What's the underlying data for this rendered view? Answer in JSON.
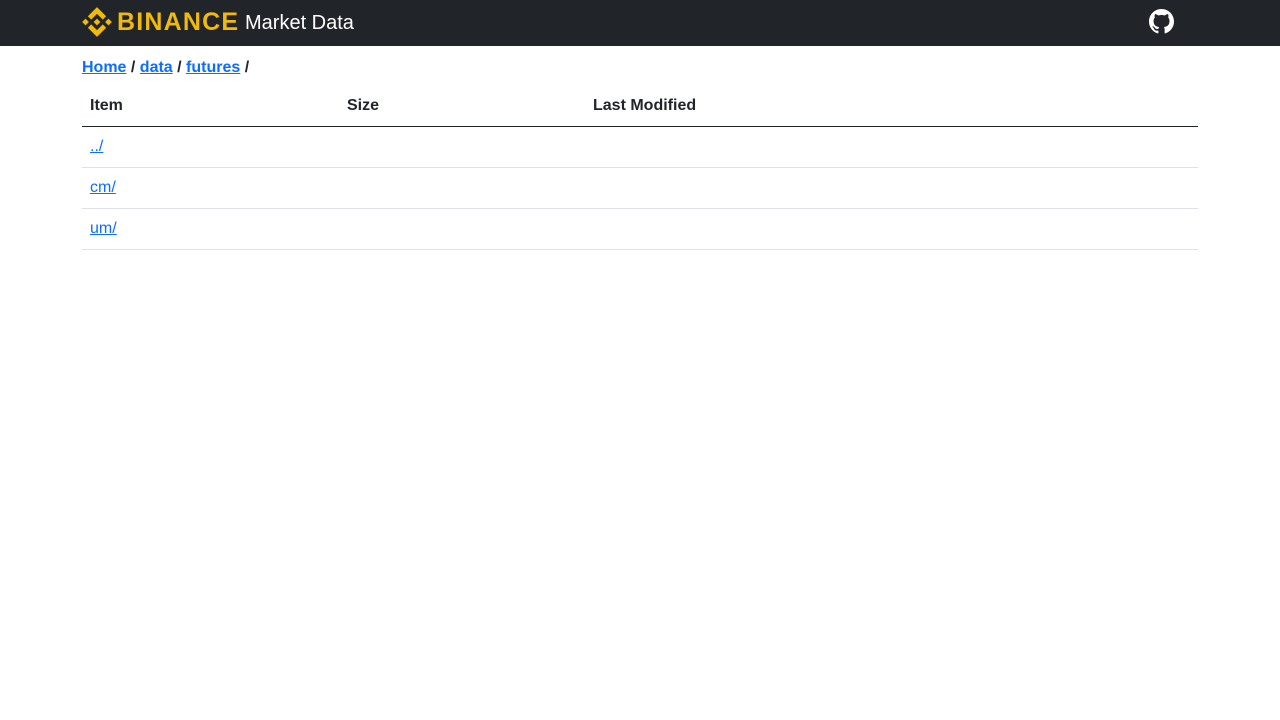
{
  "header": {
    "brand_word": "BINANCE",
    "title": "Market Data",
    "brand_color": "#f0b90b",
    "background": "#212529",
    "github_icon": "github-icon"
  },
  "breadcrumb": [
    {
      "label": "Home",
      "link": true
    },
    {
      "label": "data",
      "link": true
    },
    {
      "label": "futures",
      "link": true
    }
  ],
  "breadcrumb_separator": "/",
  "table": {
    "columns": [
      "Item",
      "Size",
      "Last Modified"
    ],
    "rows": [
      {
        "item": "../",
        "size": "",
        "modified": ""
      },
      {
        "item": "cm/",
        "size": "",
        "modified": ""
      },
      {
        "item": "um/",
        "size": "",
        "modified": ""
      }
    ]
  },
  "colors": {
    "link": "#0d6efd",
    "text": "#212529"
  }
}
